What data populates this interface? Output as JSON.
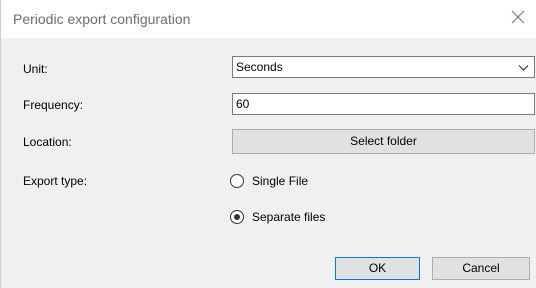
{
  "dialog": {
    "title": "Periodic export configuration",
    "close_icon": "close-icon"
  },
  "form": {
    "unit_label": "Unit:",
    "unit_value": "Seconds",
    "frequency_label": "Frequency:",
    "frequency_value": "60",
    "location_label": "Location:",
    "select_folder_label": "Select folder",
    "export_type_label": "Export type:",
    "export_options": [
      {
        "label": "Single File",
        "selected": false
      },
      {
        "label": "Separate files",
        "selected": true
      }
    ]
  },
  "footer": {
    "ok_label": "OK",
    "cancel_label": "Cancel"
  }
}
